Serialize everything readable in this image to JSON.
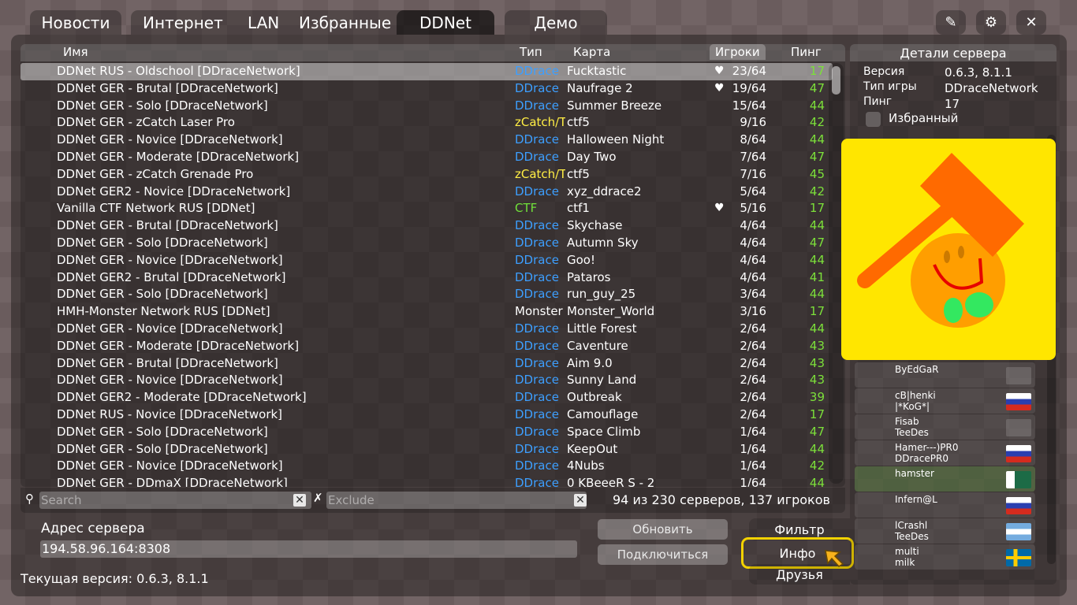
{
  "tabs": {
    "news": "Новости",
    "internet": "Интернет",
    "lan": "LAN",
    "favorites": "Избранные",
    "ddnet": "DDNet",
    "demo": "Демо"
  },
  "toolbar": {
    "edit_icon": "✎",
    "settings_icon": "⚙",
    "close_icon": "✕"
  },
  "columns": {
    "name": "Имя",
    "type": "Тип",
    "map": "Карта",
    "players": "Игроки",
    "ping": "Пинг"
  },
  "colors": {
    "ddrace": "#3d9fff",
    "zcatch": "#ffee44",
    "ctf": "#70e03a",
    "monster": "#ffffff",
    "ping": "#7ce03a"
  },
  "servers": [
    {
      "name": "DDNet RUS - Oldschool [DDraceNetwork]",
      "type": "DDrace",
      "tc": "ddrace",
      "map": "Fucktastic",
      "players": "23/64",
      "fav": true,
      "ping": "17"
    },
    {
      "name": "DDNet GER - Brutal [DDraceNetwork]",
      "type": "DDrace",
      "tc": "ddrace",
      "map": "Naufrage 2",
      "players": "19/64",
      "fav": true,
      "ping": "47"
    },
    {
      "name": "DDNet GER - Solo [DDraceNetwork]",
      "type": "DDrace",
      "tc": "ddrace",
      "map": "Summer Breeze",
      "players": "15/64",
      "fav": false,
      "ping": "44"
    },
    {
      "name": "DDNet GER - zCatch Laser Pro",
      "type": "zCatch/T",
      "tc": "zcatch",
      "map": "ctf5",
      "players": "9/16",
      "fav": false,
      "ping": "42"
    },
    {
      "name": "DDNet GER - Novice [DDraceNetwork]",
      "type": "DDrace",
      "tc": "ddrace",
      "map": "Halloween Night",
      "players": "8/64",
      "fav": false,
      "ping": "44"
    },
    {
      "name": "DDNet GER - Moderate [DDraceNetwork]",
      "type": "DDrace",
      "tc": "ddrace",
      "map": "Day Two",
      "players": "7/64",
      "fav": false,
      "ping": "47"
    },
    {
      "name": "DDNet GER - zCatch Grenade Pro",
      "type": "zCatch/T",
      "tc": "zcatch",
      "map": "ctf5",
      "players": "7/16",
      "fav": false,
      "ping": "45"
    },
    {
      "name": "DDNet GER2 - Novice [DDraceNetwork]",
      "type": "DDrace",
      "tc": "ddrace",
      "map": "xyz_ddrace2",
      "players": "5/64",
      "fav": false,
      "ping": "42"
    },
    {
      "name": "Vanilla CTF Network RUS [DDNet]",
      "type": "CTF",
      "tc": "ctf",
      "map": "ctf1",
      "players": "5/16",
      "fav": true,
      "ping": "17"
    },
    {
      "name": "DDNet GER - Brutal [DDraceNetwork]",
      "type": "DDrace",
      "tc": "ddrace",
      "map": "Skychase",
      "players": "4/64",
      "fav": false,
      "ping": "44"
    },
    {
      "name": "DDNet GER - Solo [DDraceNetwork]",
      "type": "DDrace",
      "tc": "ddrace",
      "map": "Autumn Sky",
      "players": "4/64",
      "fav": false,
      "ping": "47"
    },
    {
      "name": "DDNet GER - Novice [DDraceNetwork]",
      "type": "DDrace",
      "tc": "ddrace",
      "map": "Goo!",
      "players": "4/64",
      "fav": false,
      "ping": "44"
    },
    {
      "name": "DDNet GER2 - Brutal [DDraceNetwork]",
      "type": "DDrace",
      "tc": "ddrace",
      "map": "Pataros",
      "players": "4/64",
      "fav": false,
      "ping": "41"
    },
    {
      "name": "DDNet GER - Solo [DDraceNetwork]",
      "type": "DDrace",
      "tc": "ddrace",
      "map": "run_guy_25",
      "players": "3/64",
      "fav": false,
      "ping": "44"
    },
    {
      "name": "HMH-Monster Network RUS [DDNet]",
      "type": "Monster",
      "tc": "monster",
      "map": "Monster_World",
      "players": "3/16",
      "fav": false,
      "ping": "17"
    },
    {
      "name": "DDNet GER - Novice [DDraceNetwork]",
      "type": "DDrace",
      "tc": "ddrace",
      "map": "Little Forest",
      "players": "2/64",
      "fav": false,
      "ping": "44"
    },
    {
      "name": "DDNet GER - Moderate [DDraceNetwork]",
      "type": "DDrace",
      "tc": "ddrace",
      "map": "Caventure",
      "players": "2/64",
      "fav": false,
      "ping": "43"
    },
    {
      "name": "DDNet GER - Brutal [DDraceNetwork]",
      "type": "DDrace",
      "tc": "ddrace",
      "map": "Aim 9.0",
      "players": "2/64",
      "fav": false,
      "ping": "43"
    },
    {
      "name": "DDNet GER - Novice [DDraceNetwork]",
      "type": "DDrace",
      "tc": "ddrace",
      "map": "Sunny Land",
      "players": "2/64",
      "fav": false,
      "ping": "43"
    },
    {
      "name": "DDNet GER2 - Moderate [DDraceNetwork]",
      "type": "DDrace",
      "tc": "ddrace",
      "map": "Outbreak",
      "players": "2/64",
      "fav": false,
      "ping": "39"
    },
    {
      "name": "DDNet RUS - Novice [DDraceNetwork]",
      "type": "DDrace",
      "tc": "ddrace",
      "map": "Camouflage",
      "players": "2/64",
      "fav": false,
      "ping": "17"
    },
    {
      "name": "DDNet GER - Solo [DDraceNetwork]",
      "type": "DDrace",
      "tc": "ddrace",
      "map": "Space Climb",
      "players": "1/64",
      "fav": false,
      "ping": "47"
    },
    {
      "name": "DDNet GER - Solo [DDraceNetwork]",
      "type": "DDrace",
      "tc": "ddrace",
      "map": "KeepOut",
      "players": "1/64",
      "fav": false,
      "ping": "44"
    },
    {
      "name": "DDNet GER - Novice [DDraceNetwork]",
      "type": "DDrace",
      "tc": "ddrace",
      "map": "4Nubs",
      "players": "1/64",
      "fav": false,
      "ping": "42"
    },
    {
      "name": "DDNet GER - DDmaX [DDraceNetwork]",
      "type": "DDrace",
      "tc": "ddrace",
      "map": "0 KBeeeR S - 2",
      "players": "1/64",
      "fav": false,
      "ping": "44"
    }
  ],
  "search": {
    "placeholder": "Search",
    "icon": "⚲"
  },
  "exclude": {
    "placeholder": "Exclude",
    "icon": "✗"
  },
  "status": "94 из 230 серверов, 137 игроков",
  "address": {
    "label": "Адрес сервера",
    "value": "194.58.96.164:8308"
  },
  "buttons": {
    "refresh": "Обновить",
    "connect": "Подключиться"
  },
  "version": "Текущая версия: 0.6.3, 8.1.1",
  "side_tabs": {
    "filter": "Фильтр",
    "info": "Инфо",
    "friends": "Друзья"
  },
  "details": {
    "title": "Детали сервера",
    "version_label": "Версия",
    "version_value": "0.6.3, 8.1.1",
    "gametype_label": "Тип игры",
    "gametype_value": "DDraceNetwork",
    "ping_label": "Пинг",
    "ping_value": "17",
    "favorite_label": "Избранный"
  },
  "friends": [
    {
      "line1": "ByEdGaR",
      "line2": "",
      "flag": "default",
      "hl": false
    },
    {
      "line1": "cB|henki",
      "line2": "|*KoG*|",
      "flag": "ru",
      "hl": false
    },
    {
      "line1": "Fisab",
      "line2": "TeeDes",
      "flag": "default",
      "hl": false
    },
    {
      "line1": "Hamer---)PR0",
      "line2": "DDracePR0",
      "flag": "ru",
      "hl": false
    },
    {
      "line1": "hamster",
      "line2": "",
      "flag": "other",
      "hl": true
    },
    {
      "line1": "Infern@L",
      "line2": "",
      "flag": "ru",
      "hl": false
    },
    {
      "line1": "lCrashl",
      "line2": "TeeDes",
      "flag": "ar",
      "hl": false
    },
    {
      "line1": "multi",
      "line2": "milk",
      "flag": "se",
      "hl": false
    }
  ]
}
